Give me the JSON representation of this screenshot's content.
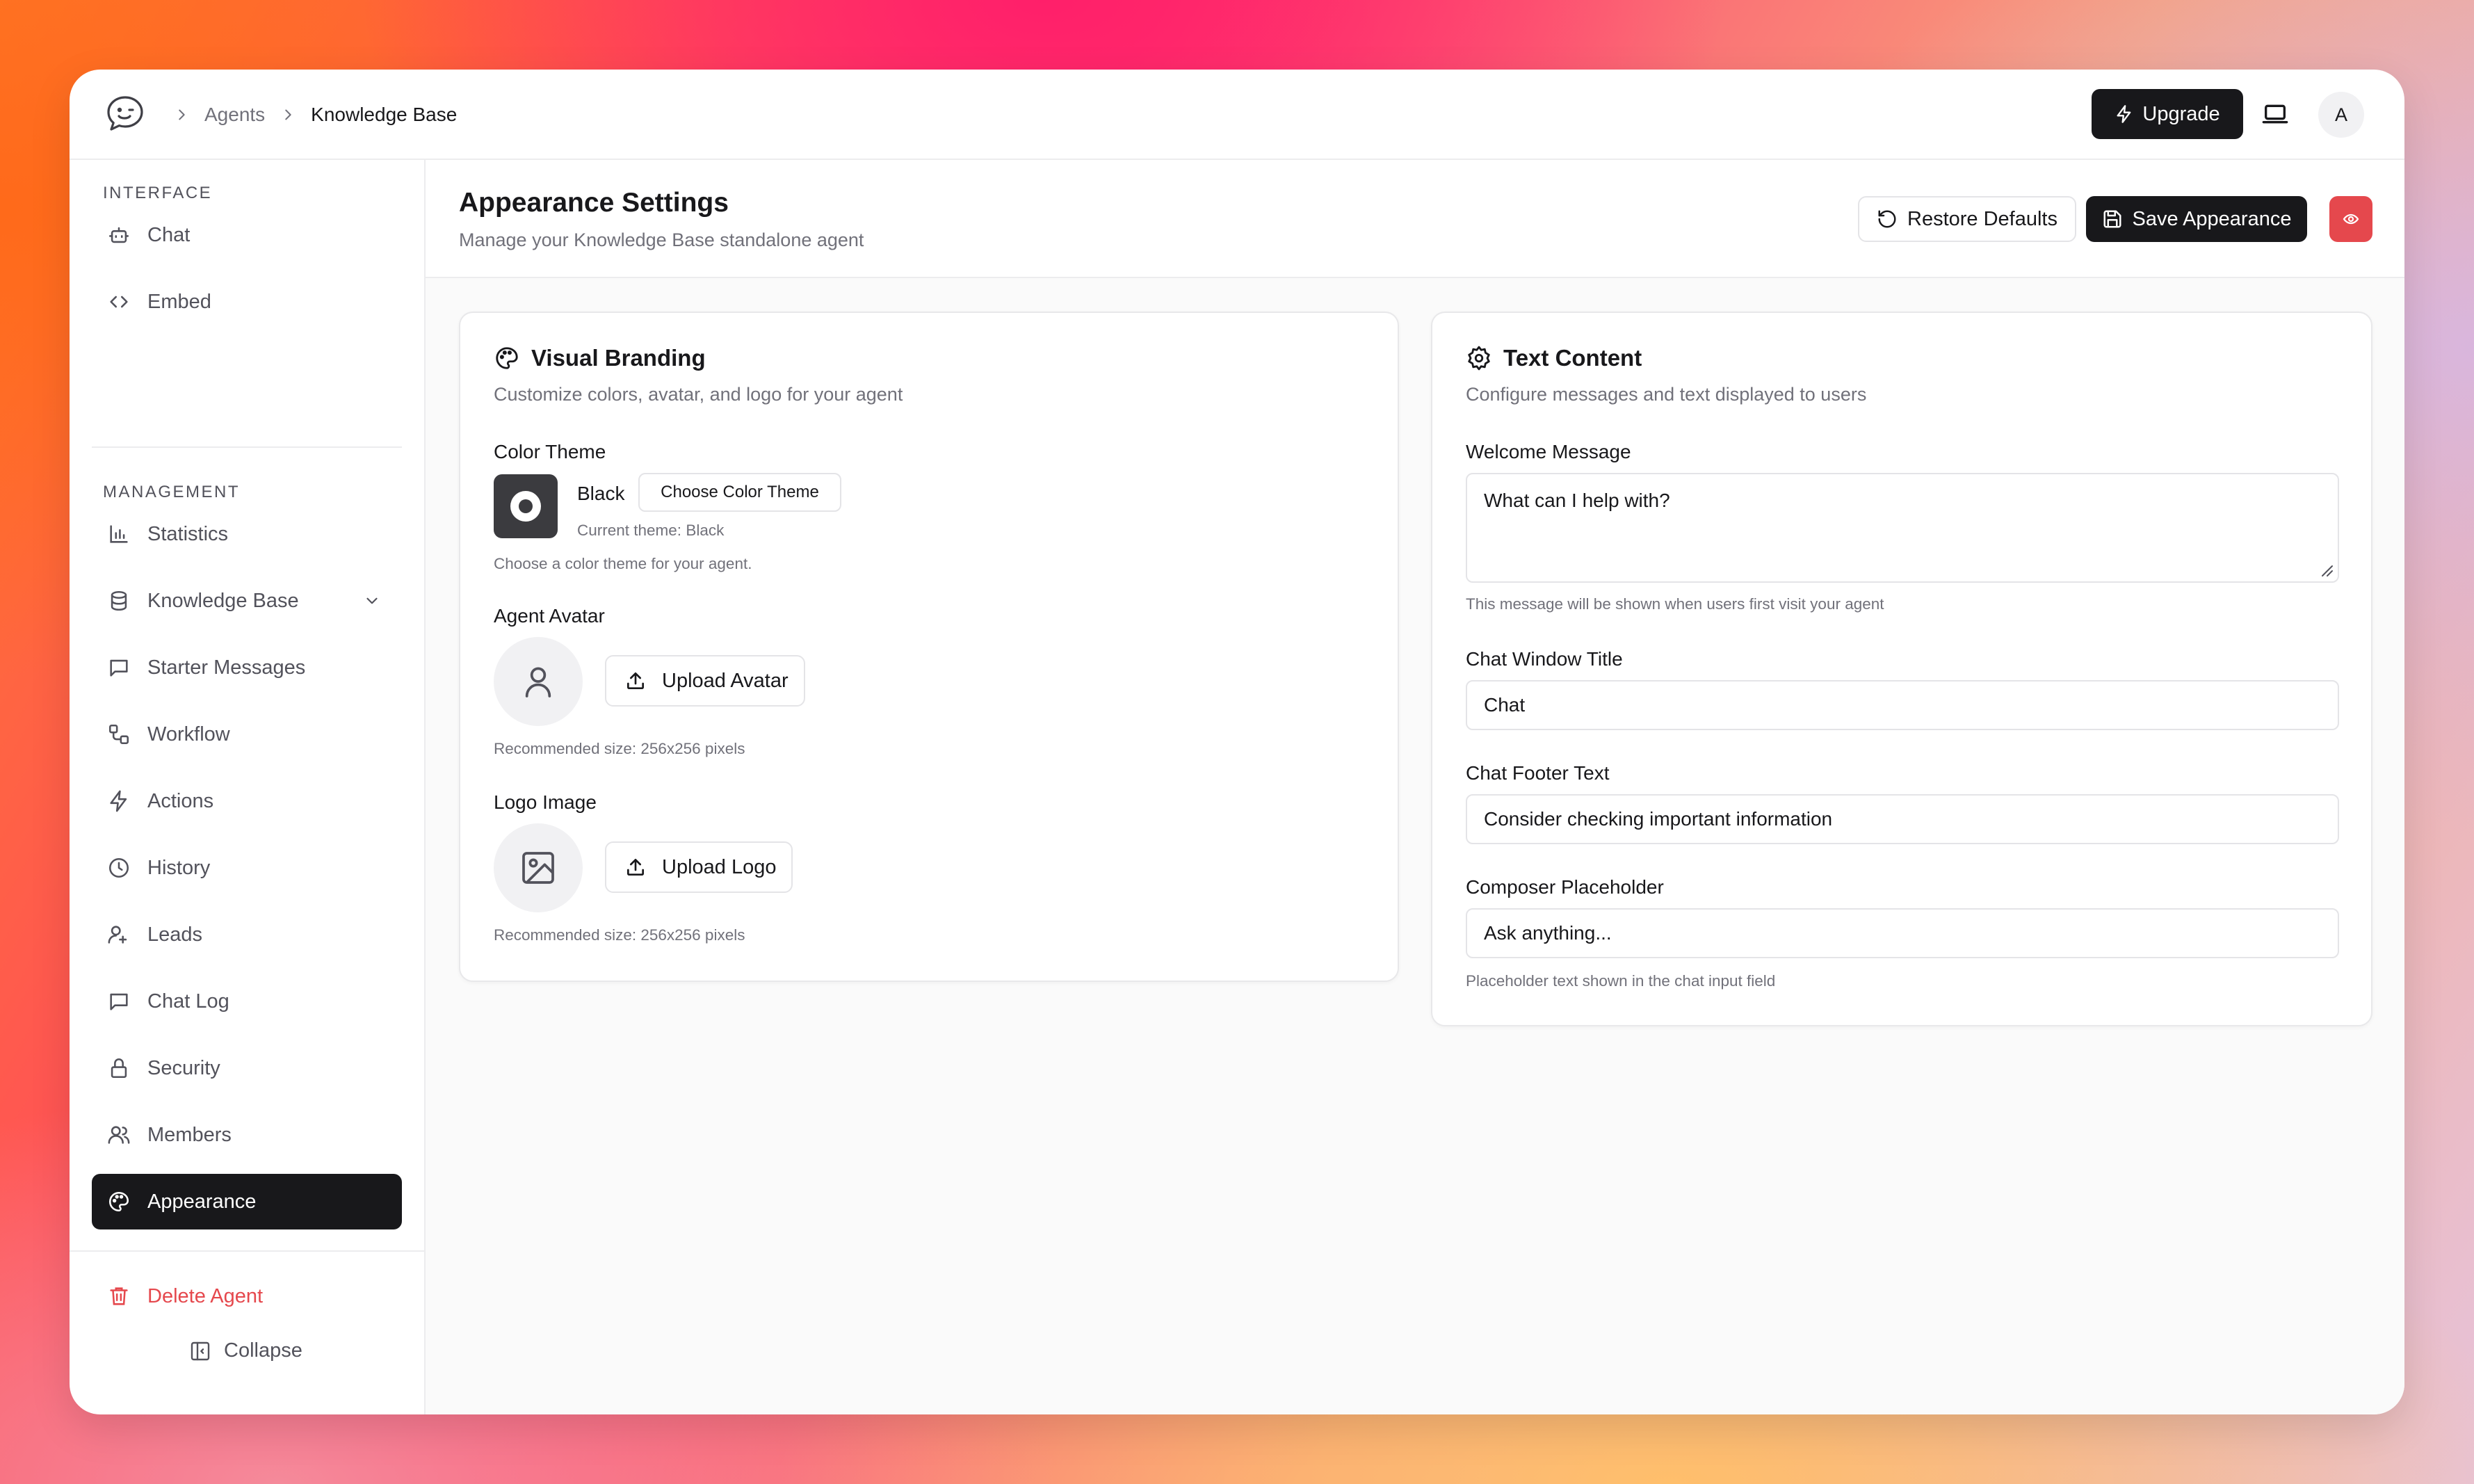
{
  "topbar": {
    "breadcrumbs": [
      "Agents",
      "Knowledge Base"
    ],
    "upgrade_label": "Upgrade",
    "avatar_initial": "A"
  },
  "sidebar": {
    "interface_title": "INTERFACE",
    "interface_items": [
      {
        "label": "Chat",
        "icon": "bot-icon"
      },
      {
        "label": "Embed",
        "icon": "code-icon"
      }
    ],
    "management_title": "MANAGEMENT",
    "management_items": [
      {
        "label": "Statistics",
        "icon": "bar-chart-icon"
      },
      {
        "label": "Knowledge Base",
        "icon": "database-icon"
      },
      {
        "label": "Starter Messages",
        "icon": "message-square-icon"
      },
      {
        "label": "Workflow",
        "icon": "workflow-icon"
      },
      {
        "label": "Actions",
        "icon": "zap-icon"
      },
      {
        "label": "History",
        "icon": "clock-icon"
      },
      {
        "label": "Leads",
        "icon": "user-plus-icon"
      },
      {
        "label": "Chat Log",
        "icon": "message-square-icon"
      },
      {
        "label": "Security",
        "icon": "lock-icon"
      },
      {
        "label": "Members",
        "icon": "users-icon"
      },
      {
        "label": "Appearance",
        "icon": "palette-icon",
        "active": true
      }
    ],
    "delete_label": "Delete Agent",
    "collapse_label": "Collapse"
  },
  "header": {
    "title": "Appearance Settings",
    "subtitle": "Manage your Knowledge Base standalone agent",
    "restore_label": "Restore Defaults",
    "save_label": "Save Appearance"
  },
  "branding": {
    "title": "Visual Branding",
    "subtitle": "Customize colors, avatar, and logo for your agent",
    "color_theme_label": "Color Theme",
    "theme_name": "Black",
    "choose_theme_label": "Choose Color Theme",
    "current_theme": "Current theme: Black",
    "theme_hint": "Choose a color theme for your agent.",
    "avatar_label": "Agent Avatar",
    "upload_avatar_label": "Upload Avatar",
    "avatar_hint": "Recommended size: 256x256 pixels",
    "logo_label": "Logo Image",
    "upload_logo_label": "Upload Logo",
    "logo_hint": "Recommended size: 256x256 pixels"
  },
  "text_content": {
    "title": "Text Content",
    "subtitle": "Configure messages and text displayed to users",
    "welcome_label": "Welcome Message",
    "welcome_value": "What can I help with?",
    "welcome_hint": "This message will be shown when users first visit your agent",
    "window_title_label": "Chat Window Title",
    "window_title_value": "Chat",
    "footer_label": "Chat Footer Text",
    "footer_value": "Consider checking important information",
    "placeholder_label": "Composer Placeholder",
    "placeholder_value": "Ask anything...",
    "placeholder_hint": "Placeholder text shown in the chat input field"
  },
  "colors": {
    "primary": "#18181b",
    "danger": "#e5484d",
    "theme_swatch": "#3b3b3f"
  }
}
